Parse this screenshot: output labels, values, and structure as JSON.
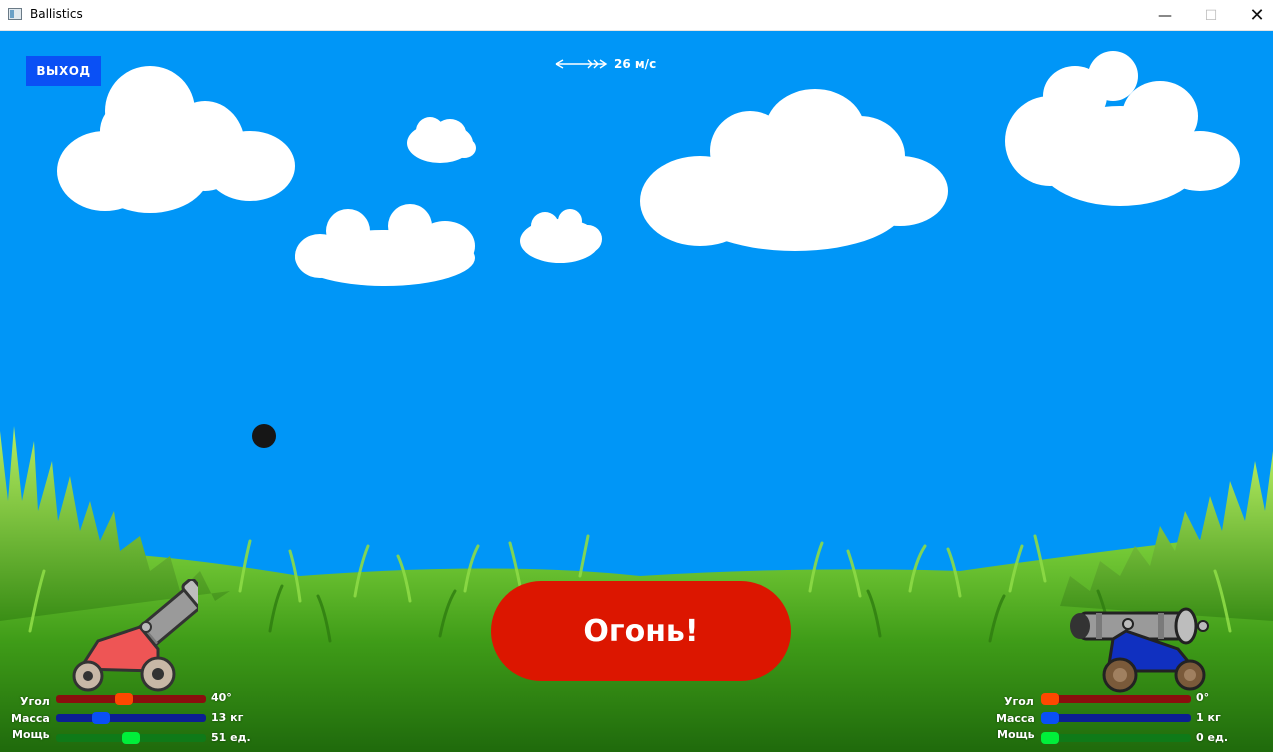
{
  "window": {
    "title": "Ballistics"
  },
  "exit_label": "ВЫХОД",
  "wind": {
    "speed_text": "26 м/с",
    "icon": "wind-arrow-icon"
  },
  "fire_label": "Огонь!",
  "colors": {
    "sky": "#0096f7",
    "fire": "#dc1600",
    "exit": "#0a50f5",
    "grass": "#3fa11a"
  },
  "left_player": {
    "angle": {
      "label": "Угол",
      "value_text": "40°",
      "fraction": 0.45
    },
    "mass": {
      "label": "Масса",
      "value_text": "13 кг",
      "fraction": 0.27
    },
    "power": {
      "label": "Мощь",
      "value_text": "51 ед.",
      "fraction": 0.5
    }
  },
  "right_player": {
    "angle": {
      "label": "Угол",
      "value_text": "0°",
      "fraction": 0.0
    },
    "mass": {
      "label": "Масса",
      "value_text": "1 кг",
      "fraction": 0.0
    },
    "power": {
      "label": "Мощь",
      "value_text": "0 ед.",
      "fraction": 0.0
    }
  }
}
